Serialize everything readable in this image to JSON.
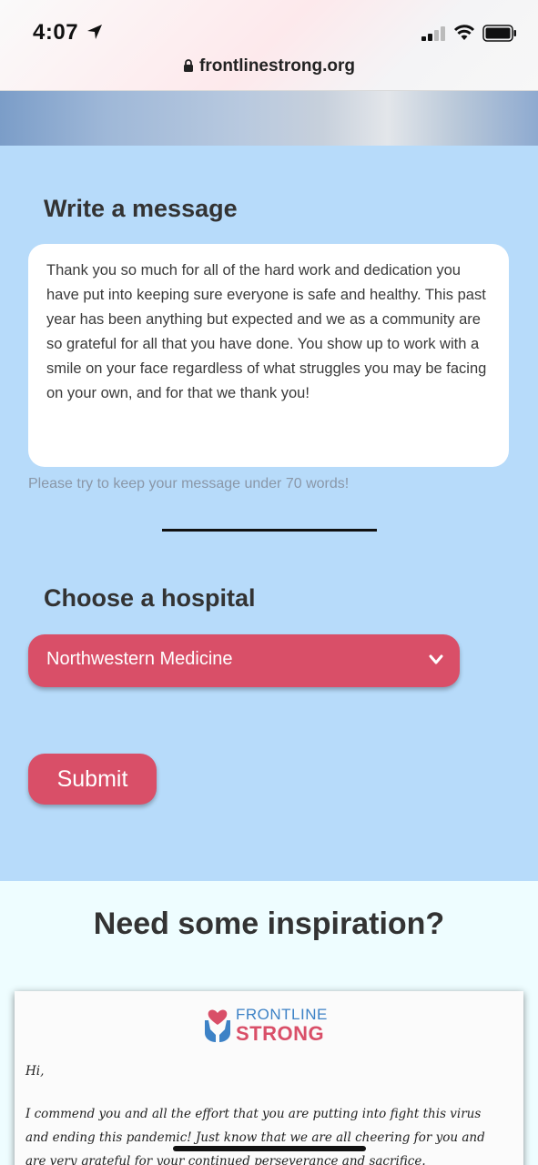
{
  "status_bar": {
    "time": "4:07"
  },
  "browser": {
    "url": "frontlinestrong.org"
  },
  "form": {
    "message_heading": "Write a message",
    "message_text": "Thank you so much for all of the hard work and dedication you have put into keeping sure everyone is safe and healthy. This past year has been anything but expected and we as a community are so grateful for all that you have done. You show up to work with a smile on your face regardless of what struggles you may be facing on your own, and for that we thank you!",
    "hint": "Please try to keep your message under 70 words!",
    "hospital_heading": "Choose a hospital",
    "hospital_selected": "Northwestern Medicine",
    "submit_label": "Submit"
  },
  "inspiration": {
    "heading": "Need some inspiration?",
    "card": {
      "logo_line1": "FRONTLINE",
      "logo_line2": "STRONG",
      "greeting": "Hi,",
      "line1": "I commend you and all the effort that you are putting into fight this virus",
      "line2": "and ending this pandemic! Just know that we are all cheering for you and",
      "line3": "are very grateful for your continued perseverance and sacrifice."
    }
  },
  "colors": {
    "accent": "#d94f68",
    "form_bg": "#b7dbfa",
    "brand_blue": "#3d82c6"
  }
}
